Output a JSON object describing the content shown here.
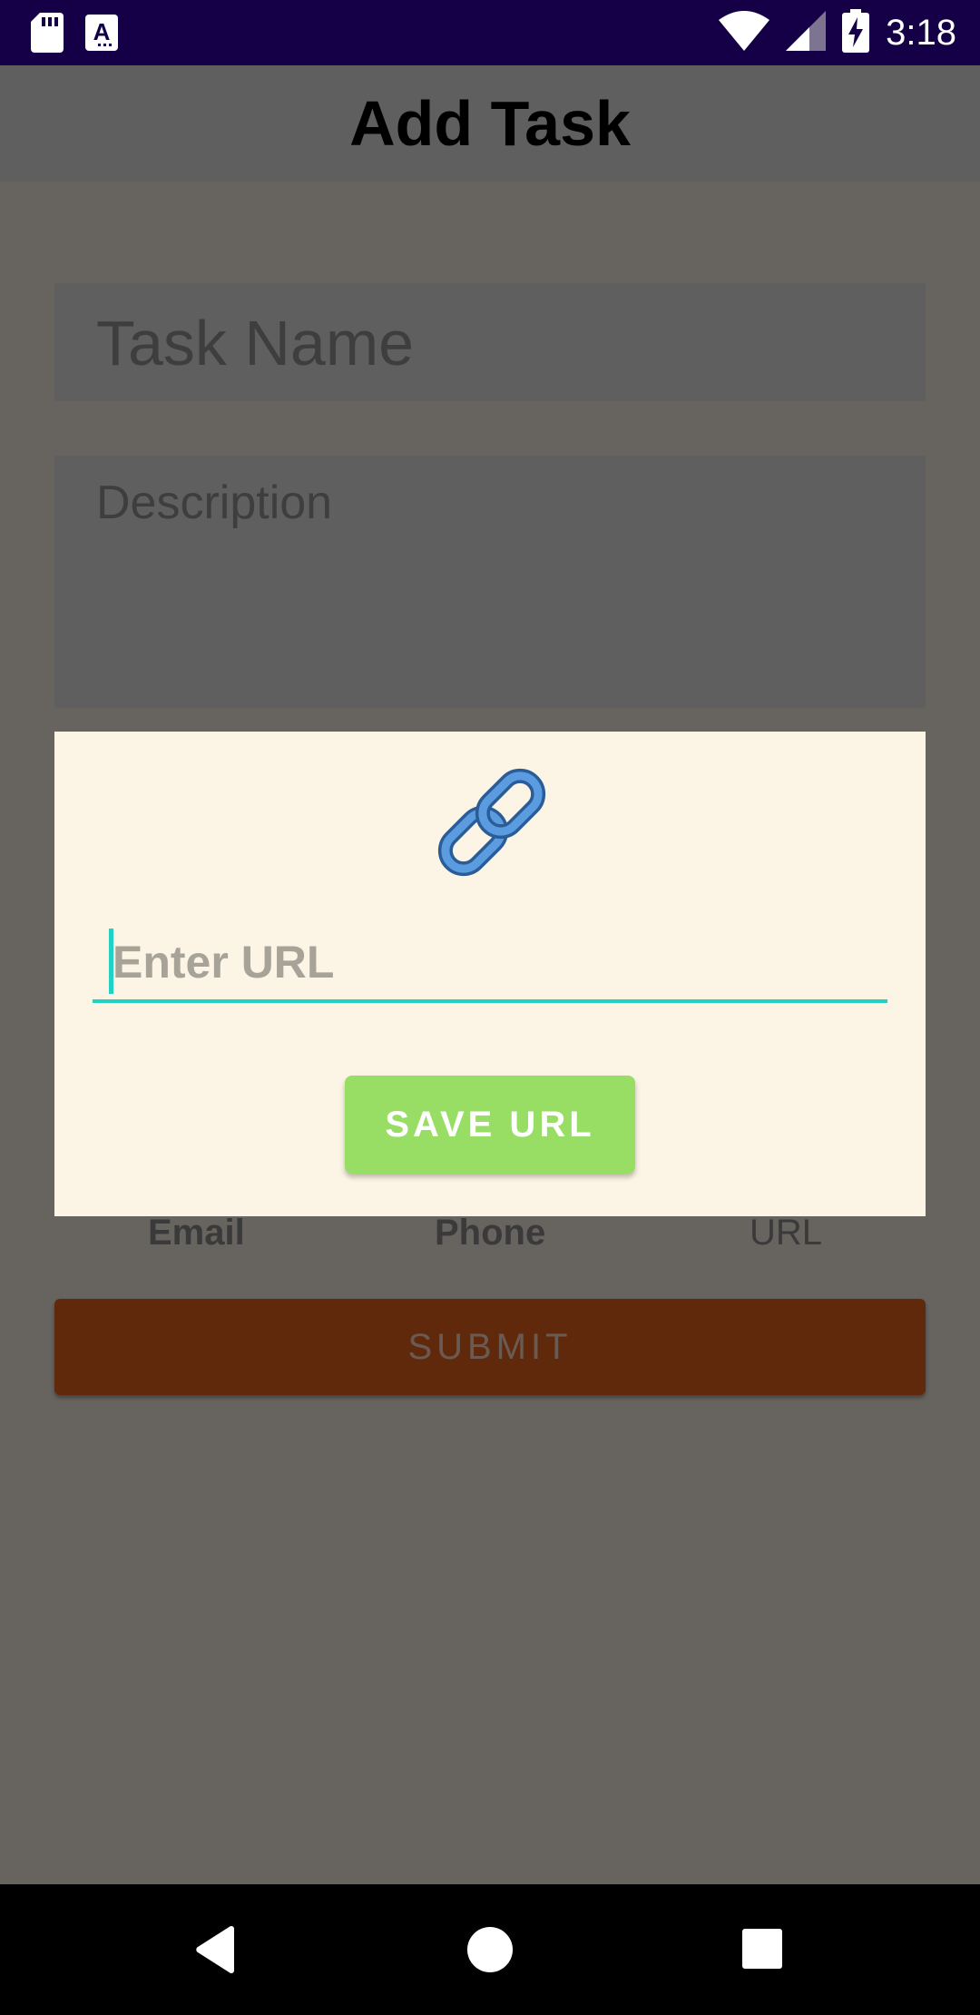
{
  "status_bar": {
    "time": "3:18",
    "icons": [
      "sd-card-icon",
      "app-notification-icon",
      "wifi-icon",
      "signal-icon",
      "battery-charging-icon"
    ]
  },
  "app_bar": {
    "title": "Add Task"
  },
  "form": {
    "task_name_placeholder": "Task Name",
    "description_placeholder": "Description",
    "contact_options": [
      "Email",
      "Phone",
      "URL"
    ],
    "submit_label": "SUBMIT"
  },
  "dialog": {
    "icon": "link-icon",
    "url_placeholder": "Enter URL",
    "save_label": "SAVE URL"
  },
  "nav_bar": {
    "icons": [
      "back-icon",
      "home-icon",
      "recents-icon"
    ]
  },
  "colors": {
    "status_bar": "#150048",
    "accent": "#21d1c2",
    "save_button": "#99de64",
    "submit_button": "#61290c",
    "dialog_bg": "#fcf4e4"
  }
}
